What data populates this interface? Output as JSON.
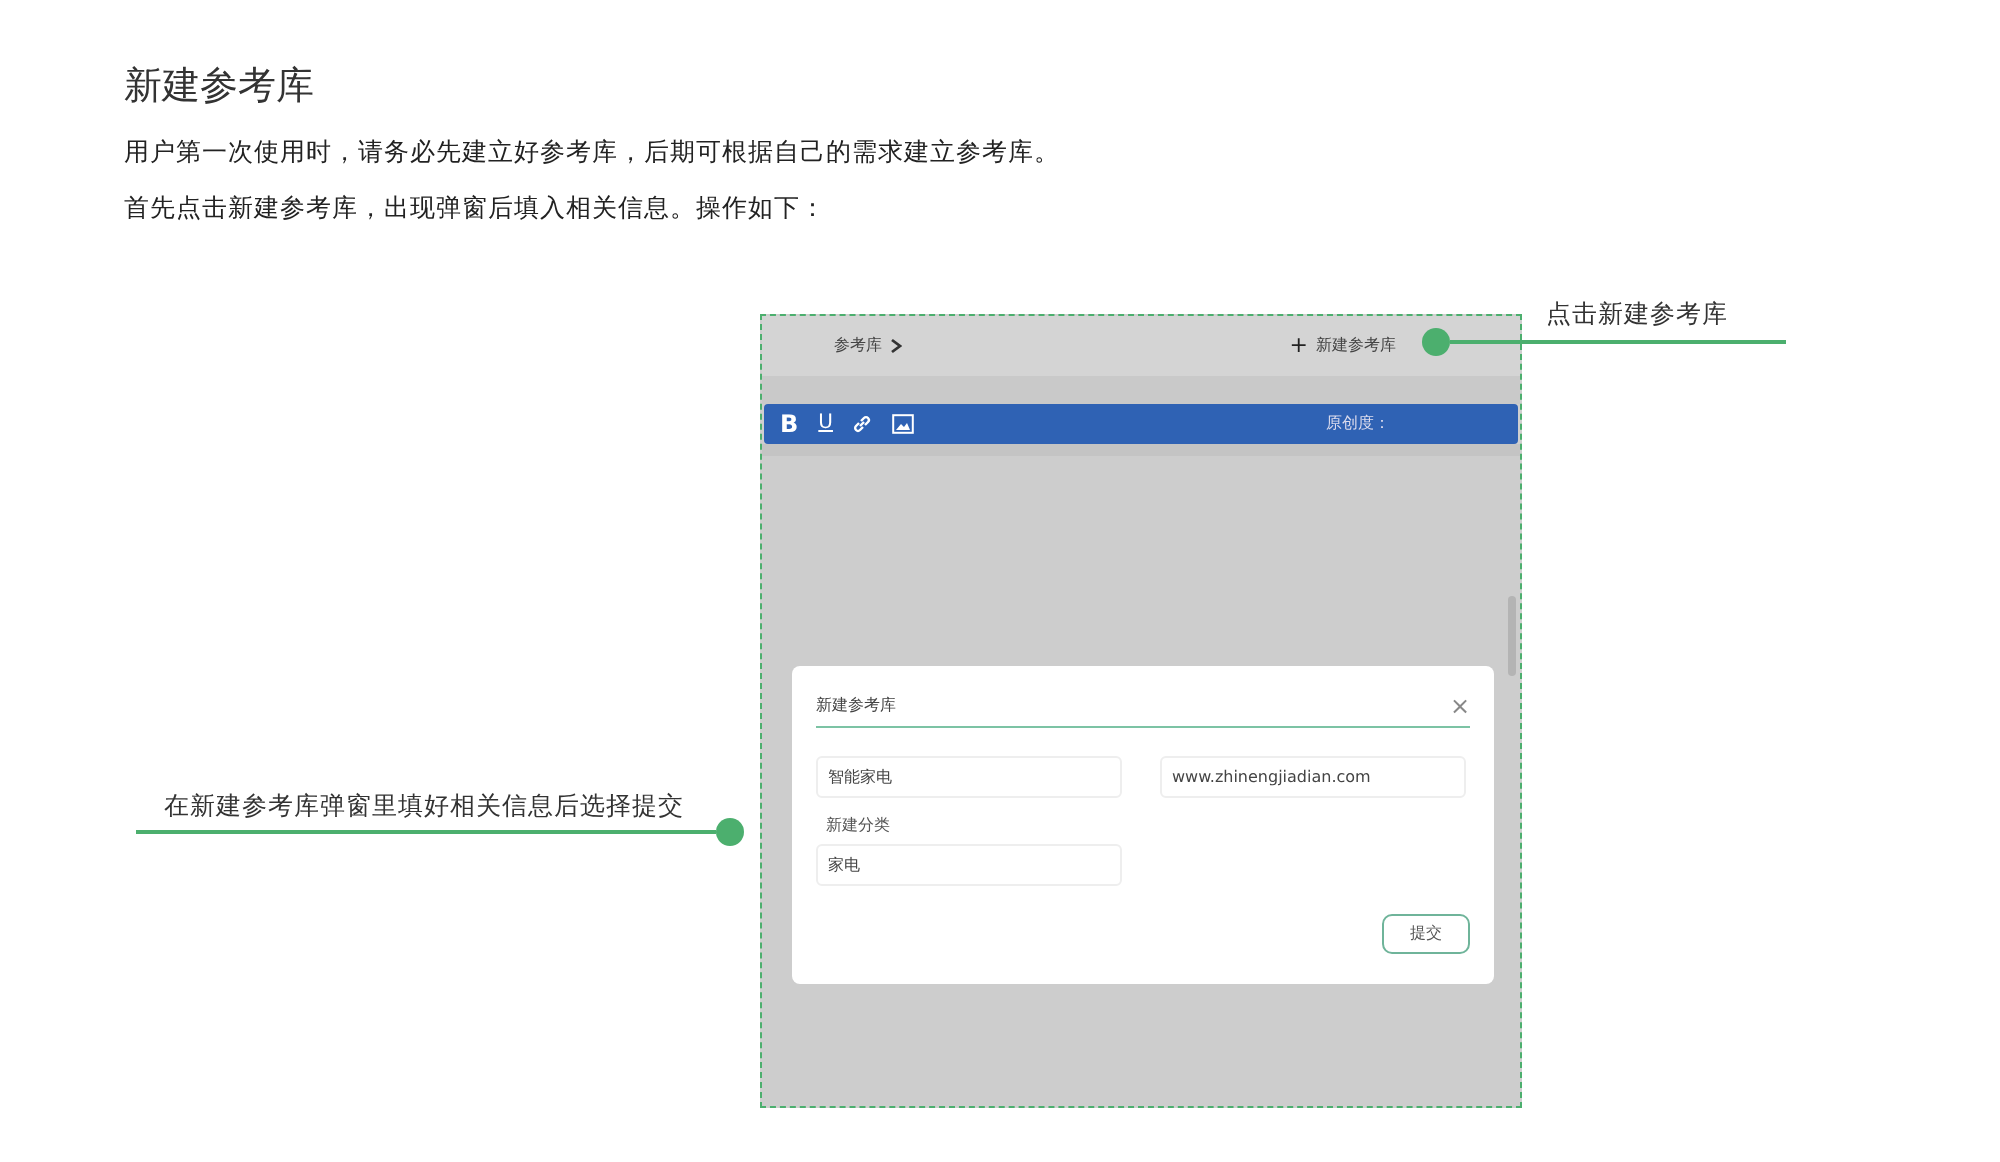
{
  "article": {
    "title": "新建参考库",
    "paragraphs": [
      "用户第一次使用时，请务必先建立好参考库，后期可根据自己的需求建立参考库。",
      "首先点击新建参考库，出现弹窗后填入相关信息。操作如下："
    ]
  },
  "screenshot": {
    "breadcrumb": "参考库",
    "new_button": {
      "plus": "+",
      "label": "新建参考库"
    },
    "toolbar": {
      "buttons": [
        {
          "kind": "bold",
          "label": "B"
        },
        {
          "kind": "underline",
          "label": "U"
        },
        {
          "kind": "link"
        },
        {
          "kind": "image"
        }
      ],
      "originality_label": "原创度："
    },
    "modal": {
      "title": "新建参考库",
      "close": "×",
      "fields": [
        {
          "value": "智能家电"
        },
        {
          "value": "www.zhinengjiadian.com"
        },
        {
          "label": "新建分类",
          "value": "家电"
        }
      ],
      "submit": "提交"
    }
  },
  "callouts": [
    {
      "kind": "right",
      "text": "点击新建参考库"
    },
    {
      "kind": "left",
      "text": "在新建参考库弹窗里填好相关信息后选择提交"
    }
  ]
}
